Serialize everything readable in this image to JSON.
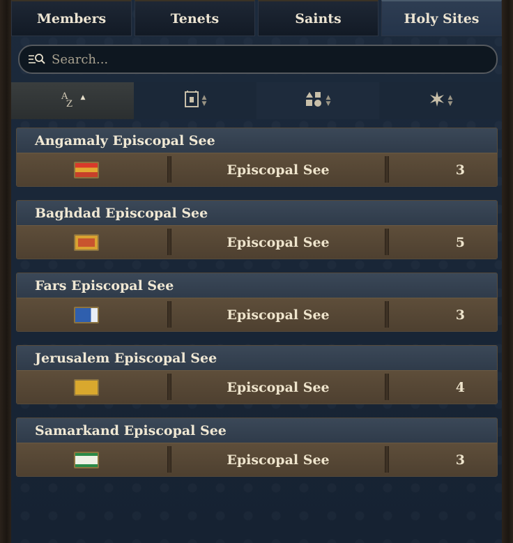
{
  "tabs": [
    {
      "label": "Members",
      "active": false
    },
    {
      "label": "Tenets",
      "active": false
    },
    {
      "label": "Saints",
      "active": false
    },
    {
      "label": "Holy Sites",
      "active": true
    }
  ],
  "search": {
    "placeholder": "Search...",
    "value": ""
  },
  "sort_buttons": [
    {
      "icon": "alphabetical-sort-icon",
      "active": true
    },
    {
      "icon": "holding-sort-icon",
      "active": false
    },
    {
      "icon": "shapes-sort-icon",
      "active": false
    },
    {
      "icon": "star-burst-sort-icon",
      "active": false
    }
  ],
  "sites": [
    {
      "name": "Angamaly Episcopal See",
      "type": "Episcopal See",
      "count": "3",
      "flag": "red-gold-striped-flag"
    },
    {
      "name": "Baghdad Episcopal See",
      "type": "Episcopal See",
      "count": "5",
      "flag": "ornate-red-gold-flag"
    },
    {
      "name": "Fars Episcopal See",
      "type": "Episcopal See",
      "count": "3",
      "flag": "blue-white-flag"
    },
    {
      "name": "Jerusalem Episcopal See",
      "type": "Episcopal See",
      "count": "4",
      "flag": "gold-crescent-flag"
    },
    {
      "name": "Samarkand Episcopal See",
      "type": "Episcopal See",
      "count": "3",
      "flag": "green-white-flag"
    }
  ],
  "colors": {
    "panel": "#1c2a3c",
    "row": "#5a4b38",
    "header": "#3b4858",
    "text": "#f0e8d4"
  }
}
